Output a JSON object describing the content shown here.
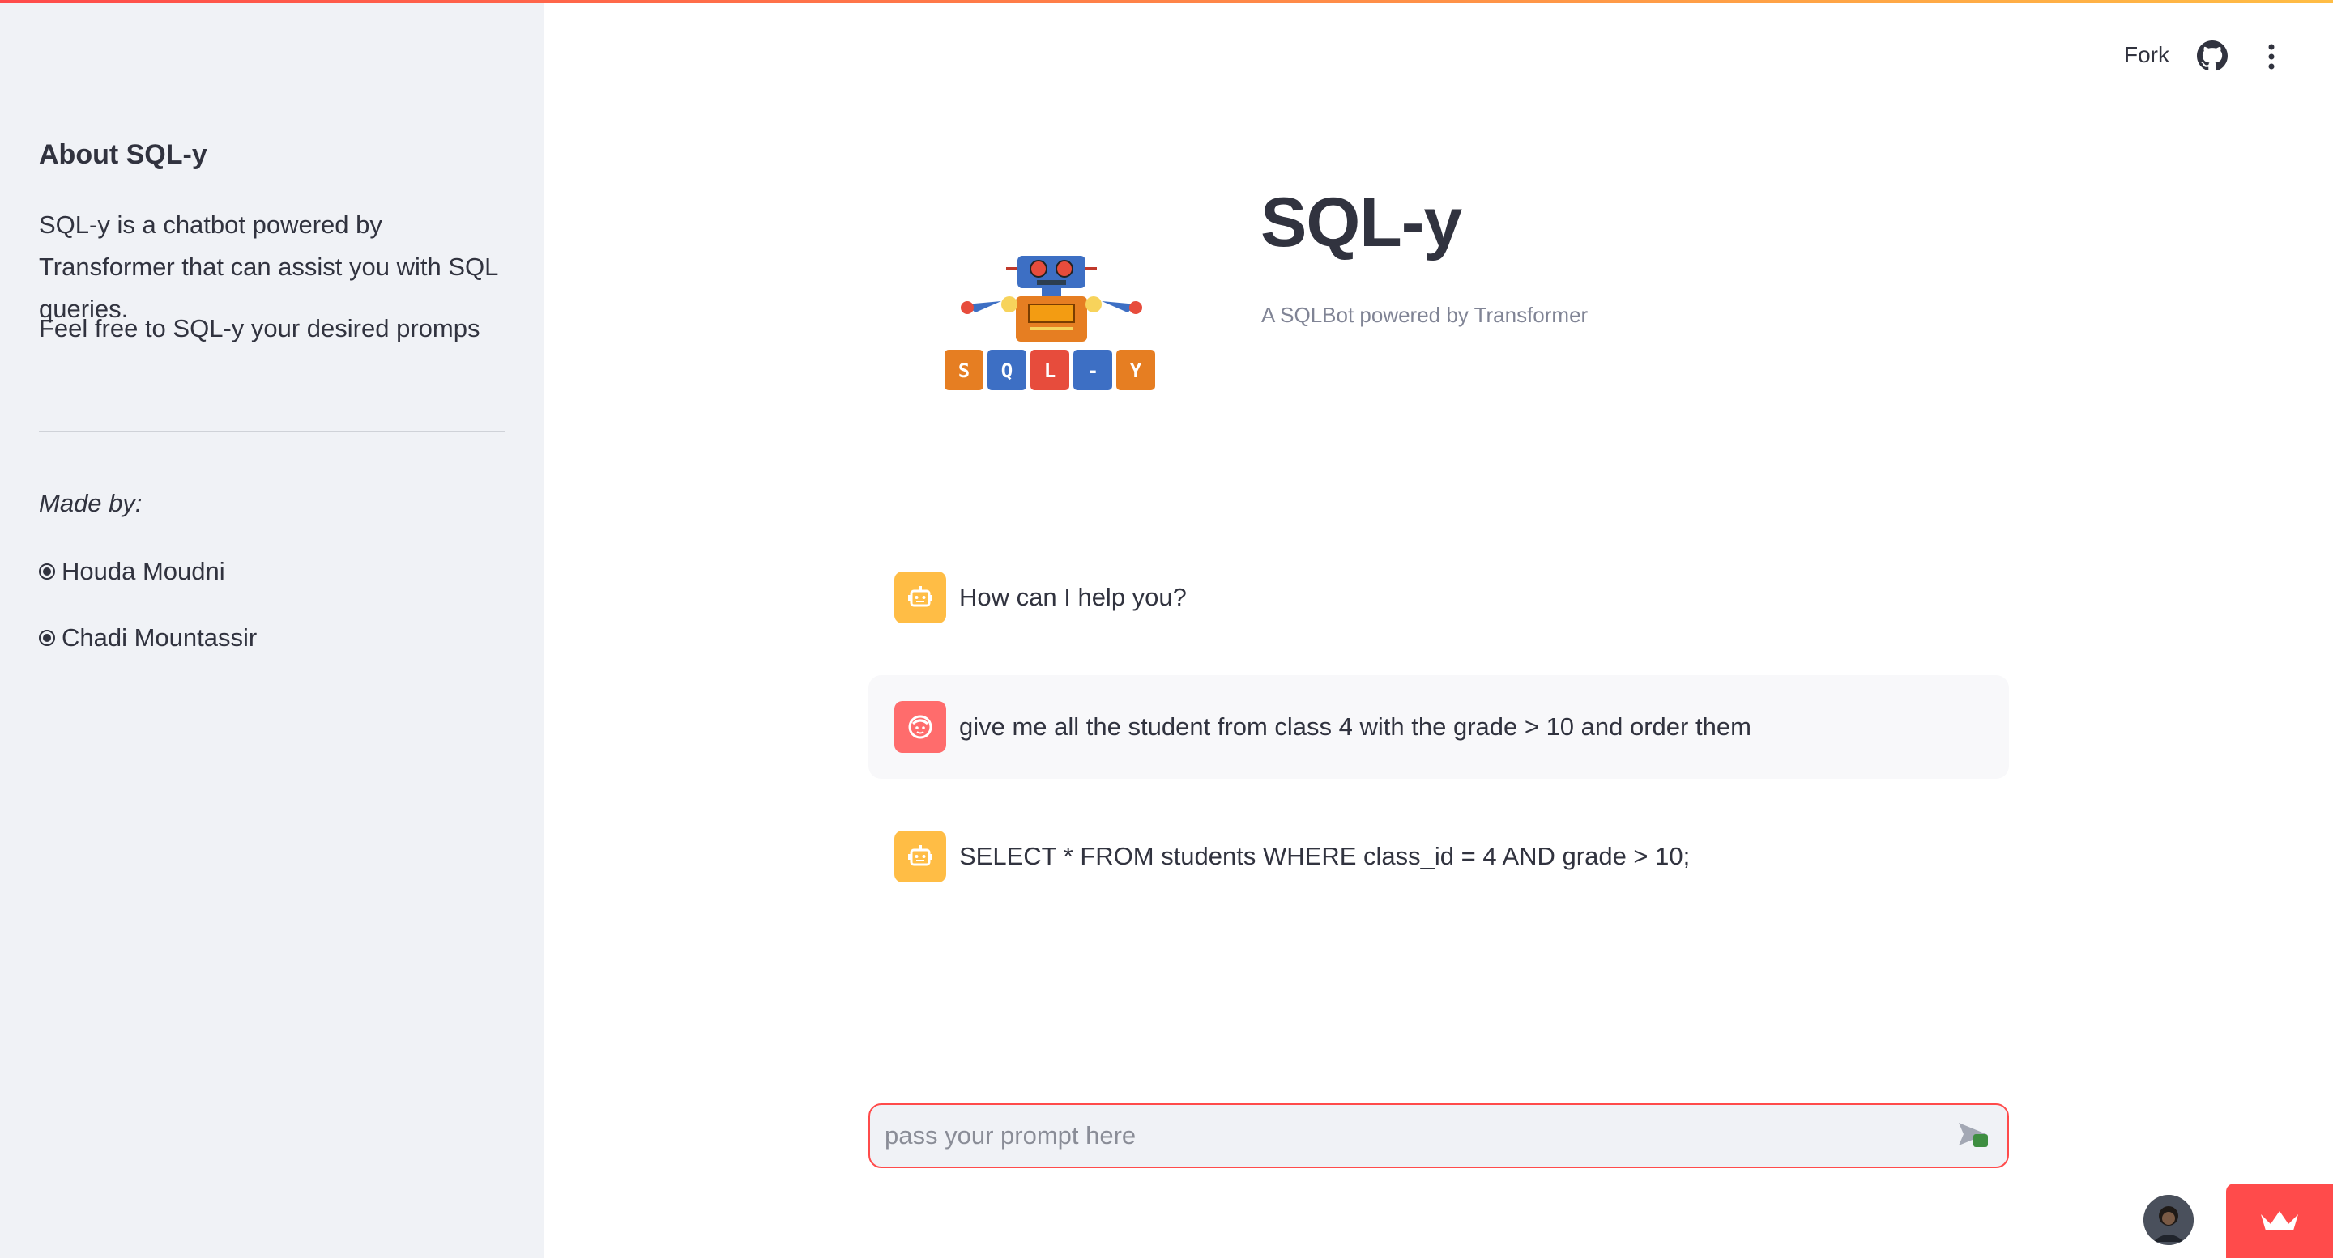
{
  "sidebar": {
    "title": "About SQL-y",
    "description": "SQL-y is a chatbot powered by Transformer that can assist you with SQL queries.",
    "description2": "Feel free to SQL-y your desired promps",
    "made_by_label": "Made by:",
    "authors": [
      "Houda Moudni",
      "Chadi Mountassir"
    ]
  },
  "header": {
    "fork_label": "Fork",
    "github_icon": "github-icon",
    "menu_icon": "kebab-menu-icon"
  },
  "hero": {
    "title": "SQL-y",
    "subtitle": "A SQLBot powered by Transformer",
    "logo_letters": [
      "S",
      "Q",
      "L",
      "-",
      "Y"
    ]
  },
  "chat": {
    "messages": [
      {
        "role": "assistant",
        "text": "How can I help you?"
      },
      {
        "role": "user",
        "text": "give me all the student from class 4 with the grade > 10 and order them"
      },
      {
        "role": "assistant",
        "text": "SELECT * FROM students WHERE class_id = 4 AND grade > 10;"
      }
    ],
    "input_placeholder": "pass your prompt here",
    "input_value": ""
  },
  "colors": {
    "accent": "#ff4b4b",
    "bot_avatar": "#ffbd45",
    "user_avatar": "#ff6c6c",
    "sidebar_bg": "#f0f2f6",
    "text": "#31333f"
  }
}
